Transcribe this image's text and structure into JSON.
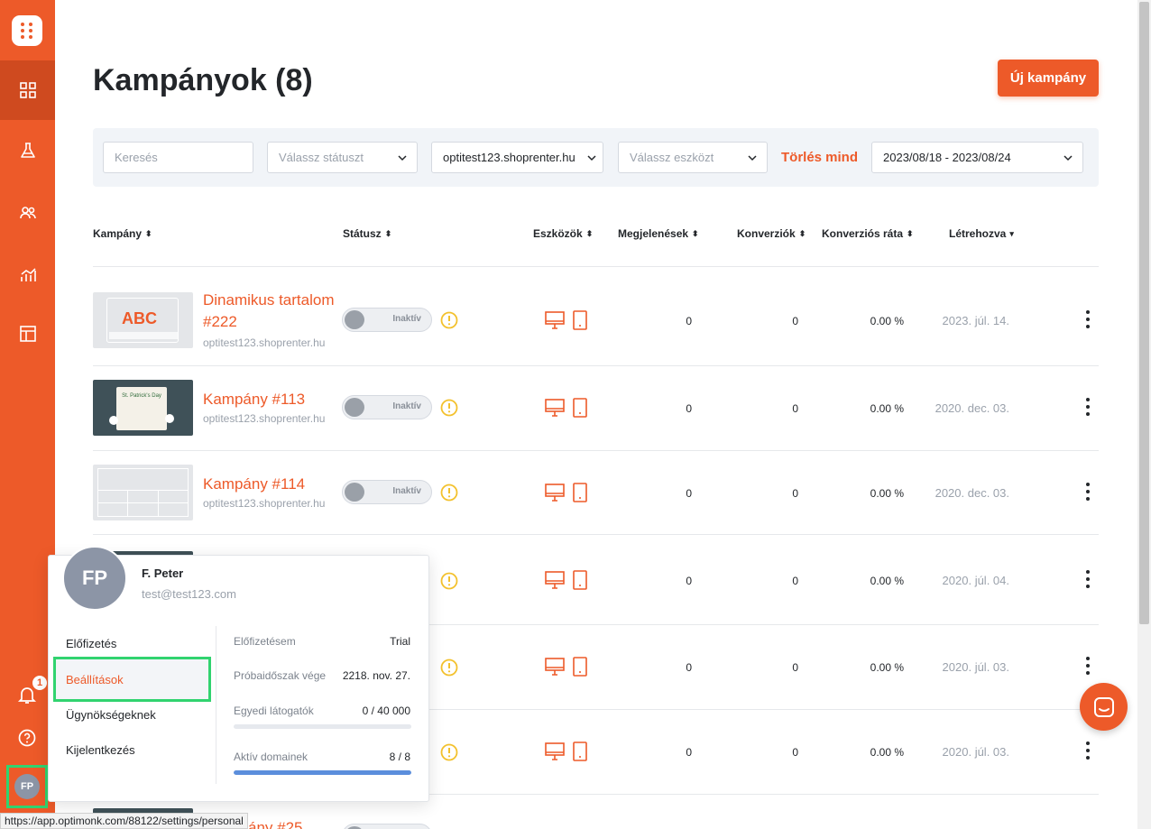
{
  "sidebar": {
    "items": [
      "dashboard-icon",
      "flask-icon",
      "users-icon",
      "analytics-icon",
      "templates-icon"
    ],
    "notification_count": "1",
    "avatar_initials": "FP"
  },
  "header": {
    "title": "Kampányok (8)",
    "new_button": "Új kampány"
  },
  "filters": {
    "search_placeholder": "Keresés",
    "status_placeholder": "Válassz státuszt",
    "domain_value": "optitest123.shoprenter.hu",
    "device_placeholder": "Válassz eszközt",
    "clear_all": "Törlés mind",
    "date_range": "2023/08/18 - 2023/08/24"
  },
  "table": {
    "columns": {
      "campaign": "Kampány",
      "status": "Státusz",
      "devices": "Eszközök",
      "impressions": "Megjelenések",
      "conversions": "Konverziók",
      "conv_rate": "Konverziós ráta",
      "created": "Létrehozva"
    },
    "rows": [
      {
        "name": "Dinamikus tartalom #222",
        "domain": "optitest123.shoprenter.hu",
        "status": "Inaktív",
        "impressions": "0",
        "conversions": "0",
        "rate": "0.00 %",
        "created": "2023. júl. 14.",
        "thumb_text": "ABC"
      },
      {
        "name": "Kampány #113",
        "domain": "optitest123.shoprenter.hu",
        "status": "Inaktív",
        "impressions": "0",
        "conversions": "0",
        "rate": "0.00 %",
        "created": "2020. dec. 03.",
        "thumb_text": "St. Patrick's Day"
      },
      {
        "name": "Kampány #114",
        "domain": "optitest123.shoprenter.hu",
        "status": "Inaktív",
        "impressions": "0",
        "conversions": "0",
        "rate": "0.00 %",
        "created": "2020. dec. 03."
      },
      {
        "impressions": "0",
        "conversions": "0",
        "rate": "0.00 %",
        "created": "2020. júl. 04."
      },
      {
        "impressions": "0",
        "conversions": "0",
        "rate": "0.00 %",
        "created": "2020. júl. 03."
      },
      {
        "impressions": "0",
        "conversions": "0",
        "rate": "0.00 %",
        "created": "2020. júl. 03."
      },
      {
        "name_partial": "ány #25"
      }
    ]
  },
  "popup": {
    "initials": "FP",
    "name": "F. Peter",
    "email": "test@test123.com",
    "menu": [
      "Előfizetés",
      "Beállítások",
      "Ügynökségeknek",
      "Kijelentkezés"
    ],
    "subscription_label": "Előfizetésem",
    "subscription_value": "Trial",
    "trial_end_label": "Próbaidőszak vége",
    "trial_end_value": "2218. nov. 27.",
    "visitors_label": "Egyedi látogatók",
    "visitors_value": "0 / 40 000",
    "visitors_fraction": 0,
    "domains_label": "Aktív domainek",
    "domains_value": "8 / 8",
    "domains_fraction": 1
  },
  "statusbar": "https://app.optimonk.com/88122/settings/personal",
  "colors": {
    "accent": "#ed5a29",
    "highlight": "#31d36f",
    "progress": "#5b8edc"
  }
}
